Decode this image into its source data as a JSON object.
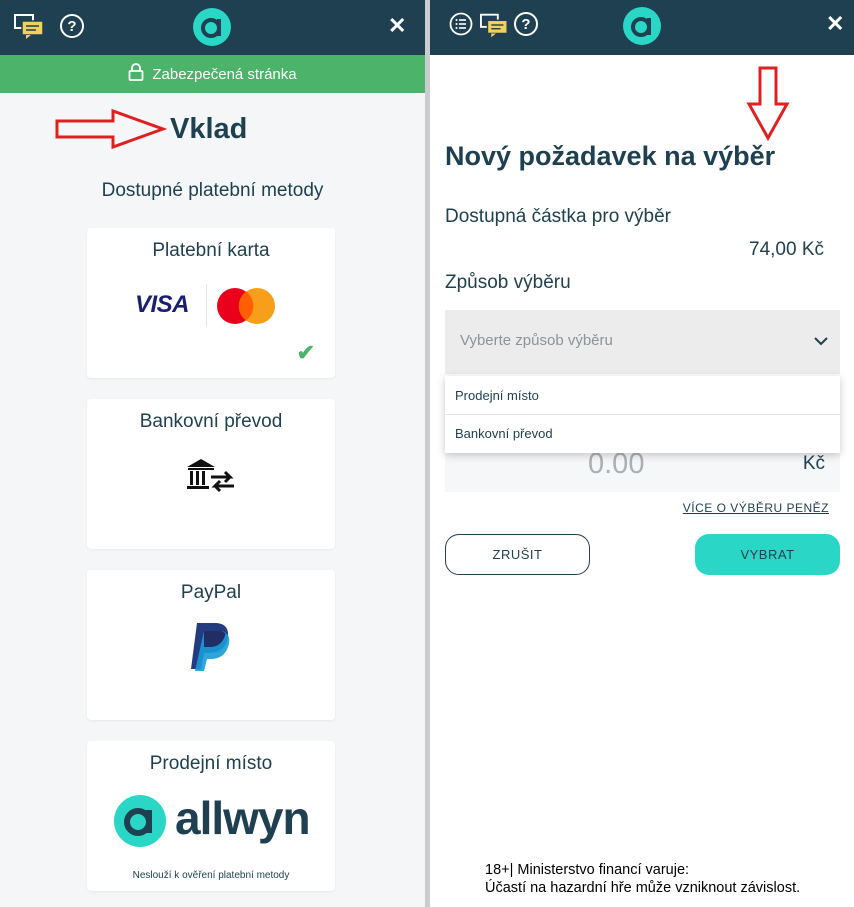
{
  "left_panel": {
    "header": {
      "chat_icon": "chat-icon",
      "help_label": "?",
      "close_label": "✕",
      "logo_letter": "a"
    },
    "secure_banner": "Zabezpečená stránka",
    "title": "Vklad",
    "subtitle": "Dostupné platební metody",
    "methods": [
      {
        "title": "Platební karta",
        "logo": "VISA"
      },
      {
        "title": "Bankovní převod"
      },
      {
        "title": "PayPal"
      },
      {
        "title": "Prodejní místo",
        "brand_letter": "a",
        "brand": "allwyn",
        "note": "Neslouží k ověření platební metody"
      }
    ]
  },
  "right_panel": {
    "header": {
      "help_label": "?",
      "close_label": "✕",
      "logo_letter": "a"
    },
    "title": "Nový požadavek na výběr",
    "available_label": "Dostupná částka pro výběr",
    "available_amount": "74,00 Kč",
    "method_label": "Způsob výběru",
    "method_placeholder": "Vyberte způsob výběru",
    "options": [
      "Prodejní místo",
      "Bankovní převod"
    ],
    "amount_placeholder": "0.00",
    "currency": "Kč",
    "more_link": "VÍCE O VÝBĚRU PENĚZ",
    "cancel_label": "ZRUŠIT",
    "submit_label": "VYBRAT",
    "warning_line1": "18+| Ministerstvo financí varuje:",
    "warning_line2": "Účastí na hazardní hře může vzniknout závislost."
  },
  "colors": {
    "header_bg": "#1e4050",
    "secure_green": "#4cb36a",
    "accent_teal": "#2ad6c6",
    "annotation_red": "#e02020"
  }
}
